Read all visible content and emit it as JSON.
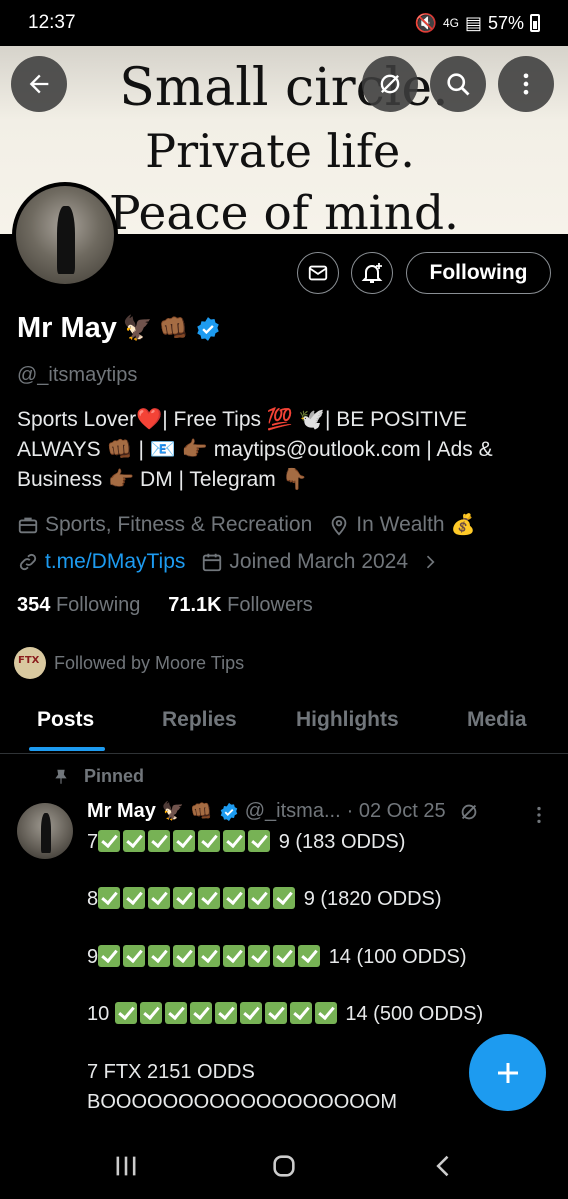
{
  "status_bar": {
    "time": "12:37",
    "battery": "57%",
    "network": "4G"
  },
  "banner": {
    "line1": "Small circle.",
    "line2": "Private life.",
    "line3": "Peace of mind."
  },
  "profile": {
    "following_button": "Following",
    "name": "Mr May",
    "handle": "@_itsmaytips",
    "bio_line1": "Sports Lover❤️| Free Tips 💯 🕊️| BE POSITIVE",
    "bio_line2": "ALWAYS 👊🏾 | 📧 👉🏾 maytips@outlook.com | Ads &",
    "bio_line3": "Business 👉🏾 DM | Telegram 👇🏾",
    "category": "Sports, Fitness & Recreation",
    "location": "In Wealth",
    "location_emoji": "💰",
    "link": "t.me/DMayTips",
    "joined": "Joined March 2024",
    "following_count": "354",
    "following_label": "Following",
    "followers_count": "71.1K",
    "followers_label": "Followers",
    "followed_by": "Followed by Moore Tips"
  },
  "tabs": [
    "Posts",
    "Replies",
    "Highlights",
    "Media"
  ],
  "post": {
    "pinned_label": "Pinned",
    "author": "Mr May",
    "handle": "@_itsma...",
    "date": "· 02 Oct 25",
    "line1_prefix": "7",
    "line1_suffix": "9 (183 ODDS)",
    "line2_prefix": "8",
    "line2_suffix": "9 (1820 ODDS)",
    "line3_prefix": "9",
    "line3_suffix": "14 (100 ODDS)",
    "line4_prefix": "10",
    "line4_suffix": "14 (500 ODDS)",
    "line5": "7 FTX 2151 ODDS",
    "line6": "BOOOOOOOOOOOOOOOOOOM"
  },
  "colors": {
    "accent": "#1d9bf0",
    "background": "#000000",
    "muted": "#71767b"
  }
}
